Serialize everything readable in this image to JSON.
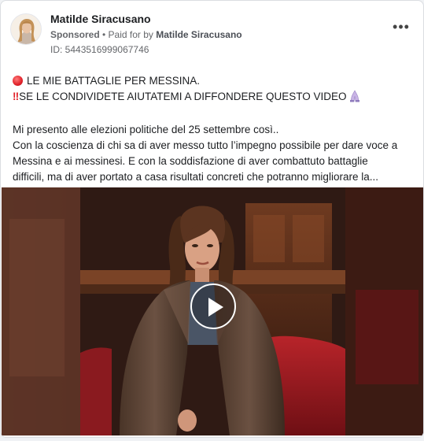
{
  "post": {
    "page_name": "Matilde Siracusano",
    "sponsored_label": "Sponsored",
    "separator": " • ",
    "paid_for_label": "Paid for by ",
    "paid_for_name": "Matilde Siracusano",
    "ad_id": "ID: 5443516999067746",
    "more_icon": "more-horizontal-icon",
    "text_lines": [
      "LE MIE BATTAGLIE PER MESSINA.",
      "SE LE CONDIVIDETE AIUTATEMI A DIFFONDERE QUESTO VIDEO",
      "Mi presento alle elezioni politiche del 25 settembre così..",
      "Con la coscienza di chi sa di aver messo tutto l’impegno possibile per dare voce a",
      "Messina e ai messinesi. E con la soddisfazione di aver combattuto battaglie",
      "difficili, ma di aver portato a casa risultati concreti che potranno migliorare la..."
    ],
    "bang_glyph": "‼",
    "video": {
      "play_icon": "play-icon"
    }
  },
  "colors": {
    "secondary_text": "#65676b",
    "card_border": "#dadde1",
    "red_emoji": "#e0222a"
  }
}
